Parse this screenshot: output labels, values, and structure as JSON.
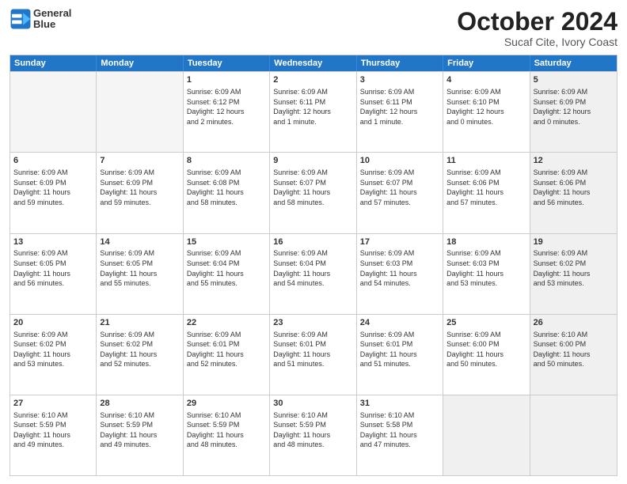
{
  "header": {
    "logo_line1": "General",
    "logo_line2": "Blue",
    "month": "October 2024",
    "location": "Sucaf Cite, Ivory Coast"
  },
  "days_of_week": [
    "Sunday",
    "Monday",
    "Tuesday",
    "Wednesday",
    "Thursday",
    "Friday",
    "Saturday"
  ],
  "rows": [
    [
      {
        "day": "",
        "empty": true
      },
      {
        "day": "",
        "empty": true
      },
      {
        "day": "1",
        "lines": [
          "Sunrise: 6:09 AM",
          "Sunset: 6:12 PM",
          "Daylight: 12 hours",
          "and 2 minutes."
        ]
      },
      {
        "day": "2",
        "lines": [
          "Sunrise: 6:09 AM",
          "Sunset: 6:11 PM",
          "Daylight: 12 hours",
          "and 1 minute."
        ]
      },
      {
        "day": "3",
        "lines": [
          "Sunrise: 6:09 AM",
          "Sunset: 6:11 PM",
          "Daylight: 12 hours",
          "and 1 minute."
        ]
      },
      {
        "day": "4",
        "lines": [
          "Sunrise: 6:09 AM",
          "Sunset: 6:10 PM",
          "Daylight: 12 hours",
          "and 0 minutes."
        ]
      },
      {
        "day": "5",
        "lines": [
          "Sunrise: 6:09 AM",
          "Sunset: 6:09 PM",
          "Daylight: 12 hours",
          "and 0 minutes."
        ],
        "shaded": true
      }
    ],
    [
      {
        "day": "6",
        "lines": [
          "Sunrise: 6:09 AM",
          "Sunset: 6:09 PM",
          "Daylight: 11 hours",
          "and 59 minutes."
        ]
      },
      {
        "day": "7",
        "lines": [
          "Sunrise: 6:09 AM",
          "Sunset: 6:09 PM",
          "Daylight: 11 hours",
          "and 59 minutes."
        ]
      },
      {
        "day": "8",
        "lines": [
          "Sunrise: 6:09 AM",
          "Sunset: 6:08 PM",
          "Daylight: 11 hours",
          "and 58 minutes."
        ]
      },
      {
        "day": "9",
        "lines": [
          "Sunrise: 6:09 AM",
          "Sunset: 6:07 PM",
          "Daylight: 11 hours",
          "and 58 minutes."
        ]
      },
      {
        "day": "10",
        "lines": [
          "Sunrise: 6:09 AM",
          "Sunset: 6:07 PM",
          "Daylight: 11 hours",
          "and 57 minutes."
        ]
      },
      {
        "day": "11",
        "lines": [
          "Sunrise: 6:09 AM",
          "Sunset: 6:06 PM",
          "Daylight: 11 hours",
          "and 57 minutes."
        ]
      },
      {
        "day": "12",
        "lines": [
          "Sunrise: 6:09 AM",
          "Sunset: 6:06 PM",
          "Daylight: 11 hours",
          "and 56 minutes."
        ],
        "shaded": true
      }
    ],
    [
      {
        "day": "13",
        "lines": [
          "Sunrise: 6:09 AM",
          "Sunset: 6:05 PM",
          "Daylight: 11 hours",
          "and 56 minutes."
        ]
      },
      {
        "day": "14",
        "lines": [
          "Sunrise: 6:09 AM",
          "Sunset: 6:05 PM",
          "Daylight: 11 hours",
          "and 55 minutes."
        ]
      },
      {
        "day": "15",
        "lines": [
          "Sunrise: 6:09 AM",
          "Sunset: 6:04 PM",
          "Daylight: 11 hours",
          "and 55 minutes."
        ]
      },
      {
        "day": "16",
        "lines": [
          "Sunrise: 6:09 AM",
          "Sunset: 6:04 PM",
          "Daylight: 11 hours",
          "and 54 minutes."
        ]
      },
      {
        "day": "17",
        "lines": [
          "Sunrise: 6:09 AM",
          "Sunset: 6:03 PM",
          "Daylight: 11 hours",
          "and 54 minutes."
        ]
      },
      {
        "day": "18",
        "lines": [
          "Sunrise: 6:09 AM",
          "Sunset: 6:03 PM",
          "Daylight: 11 hours",
          "and 53 minutes."
        ]
      },
      {
        "day": "19",
        "lines": [
          "Sunrise: 6:09 AM",
          "Sunset: 6:02 PM",
          "Daylight: 11 hours",
          "and 53 minutes."
        ],
        "shaded": true
      }
    ],
    [
      {
        "day": "20",
        "lines": [
          "Sunrise: 6:09 AM",
          "Sunset: 6:02 PM",
          "Daylight: 11 hours",
          "and 53 minutes."
        ]
      },
      {
        "day": "21",
        "lines": [
          "Sunrise: 6:09 AM",
          "Sunset: 6:02 PM",
          "Daylight: 11 hours",
          "and 52 minutes."
        ]
      },
      {
        "day": "22",
        "lines": [
          "Sunrise: 6:09 AM",
          "Sunset: 6:01 PM",
          "Daylight: 11 hours",
          "and 52 minutes."
        ]
      },
      {
        "day": "23",
        "lines": [
          "Sunrise: 6:09 AM",
          "Sunset: 6:01 PM",
          "Daylight: 11 hours",
          "and 51 minutes."
        ]
      },
      {
        "day": "24",
        "lines": [
          "Sunrise: 6:09 AM",
          "Sunset: 6:01 PM",
          "Daylight: 11 hours",
          "and 51 minutes."
        ]
      },
      {
        "day": "25",
        "lines": [
          "Sunrise: 6:09 AM",
          "Sunset: 6:00 PM",
          "Daylight: 11 hours",
          "and 50 minutes."
        ]
      },
      {
        "day": "26",
        "lines": [
          "Sunrise: 6:10 AM",
          "Sunset: 6:00 PM",
          "Daylight: 11 hours",
          "and 50 minutes."
        ],
        "shaded": true
      }
    ],
    [
      {
        "day": "27",
        "lines": [
          "Sunrise: 6:10 AM",
          "Sunset: 5:59 PM",
          "Daylight: 11 hours",
          "and 49 minutes."
        ]
      },
      {
        "day": "28",
        "lines": [
          "Sunrise: 6:10 AM",
          "Sunset: 5:59 PM",
          "Daylight: 11 hours",
          "and 49 minutes."
        ]
      },
      {
        "day": "29",
        "lines": [
          "Sunrise: 6:10 AM",
          "Sunset: 5:59 PM",
          "Daylight: 11 hours",
          "and 48 minutes."
        ]
      },
      {
        "day": "30",
        "lines": [
          "Sunrise: 6:10 AM",
          "Sunset: 5:59 PM",
          "Daylight: 11 hours",
          "and 48 minutes."
        ]
      },
      {
        "day": "31",
        "lines": [
          "Sunrise: 6:10 AM",
          "Sunset: 5:58 PM",
          "Daylight: 11 hours",
          "and 47 minutes."
        ]
      },
      {
        "day": "",
        "empty": true,
        "shaded": true
      },
      {
        "day": "",
        "empty": true,
        "shaded": true
      }
    ]
  ]
}
